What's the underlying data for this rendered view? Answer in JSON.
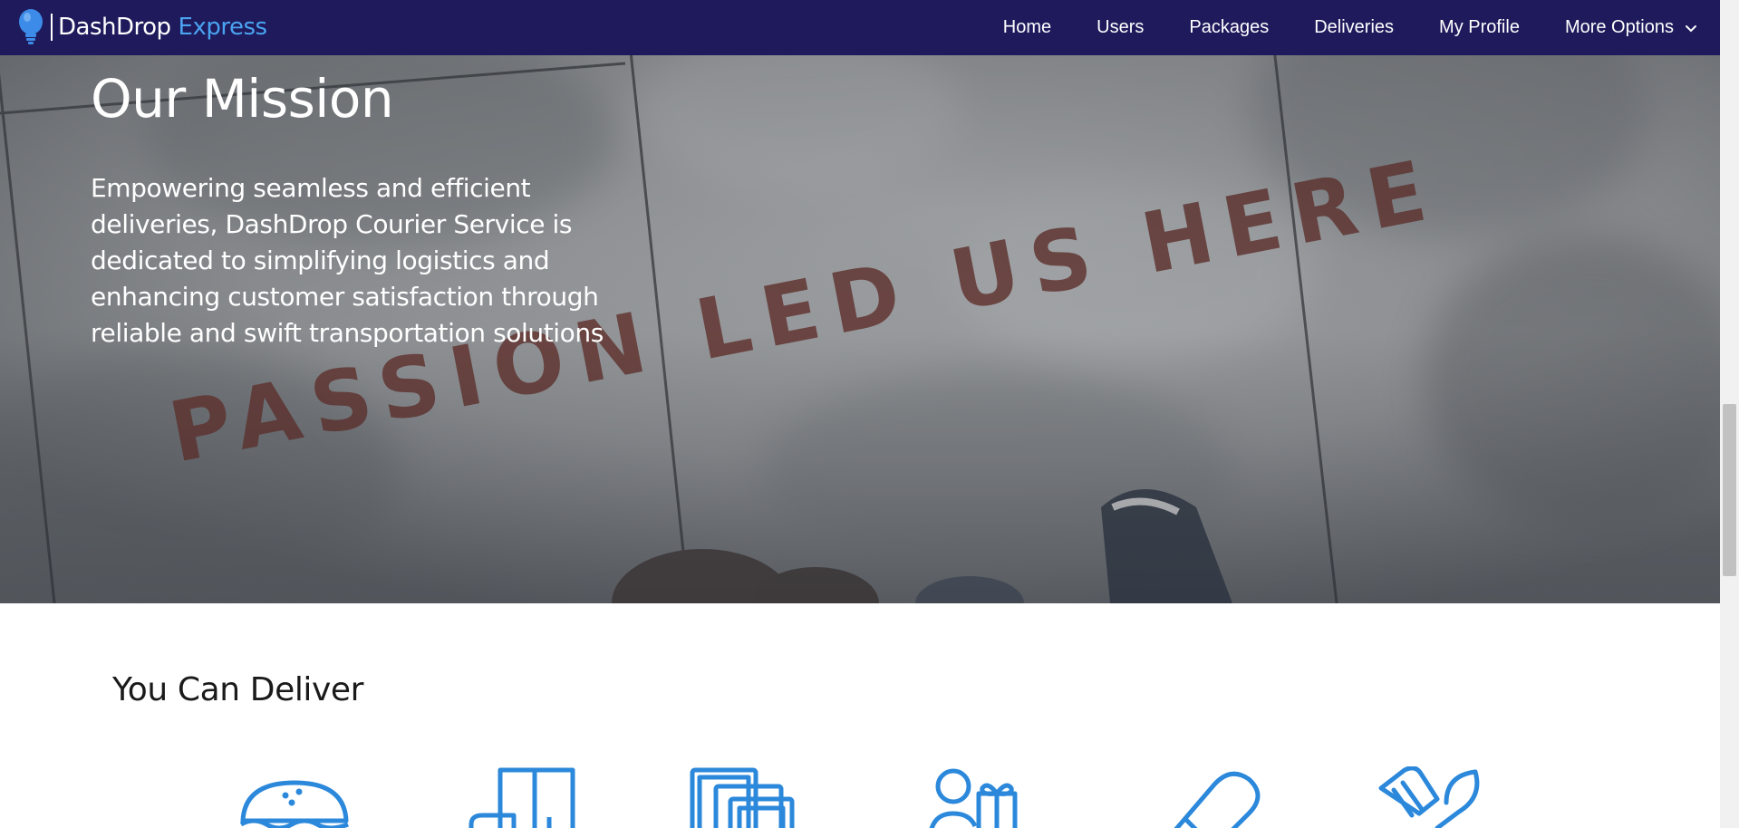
{
  "brand": {
    "name": "DashDrop",
    "accent": "Express",
    "logo_icon": "lightbulb-icon"
  },
  "nav": {
    "home": "Home",
    "users": "Users",
    "packages": "Packages",
    "deliveries": "Deliveries",
    "profile": "My Profile",
    "more": "More Options"
  },
  "hero": {
    "title": "Our Mission",
    "text": "Empowering seamless and efficient deliveries, DashDrop Courier Service is dedicated to simplifying logistics and enhancing customer satisfaction through reliable and swift transportation solutions",
    "background_words": "PASSION LED US HERE"
  },
  "section": {
    "title": "You Can Deliver",
    "categories": [
      {
        "icon": "burger-icon"
      },
      {
        "icon": "furniture-icon"
      },
      {
        "icon": "documents-icon"
      },
      {
        "icon": "person-gift-icon"
      },
      {
        "icon": "medicine-icon"
      },
      {
        "icon": "utensils-icon"
      }
    ]
  },
  "colors": {
    "navbar": "#1e1a5c",
    "brand_accent": "#4aa3f0",
    "icon_blue": "#2b88db"
  }
}
